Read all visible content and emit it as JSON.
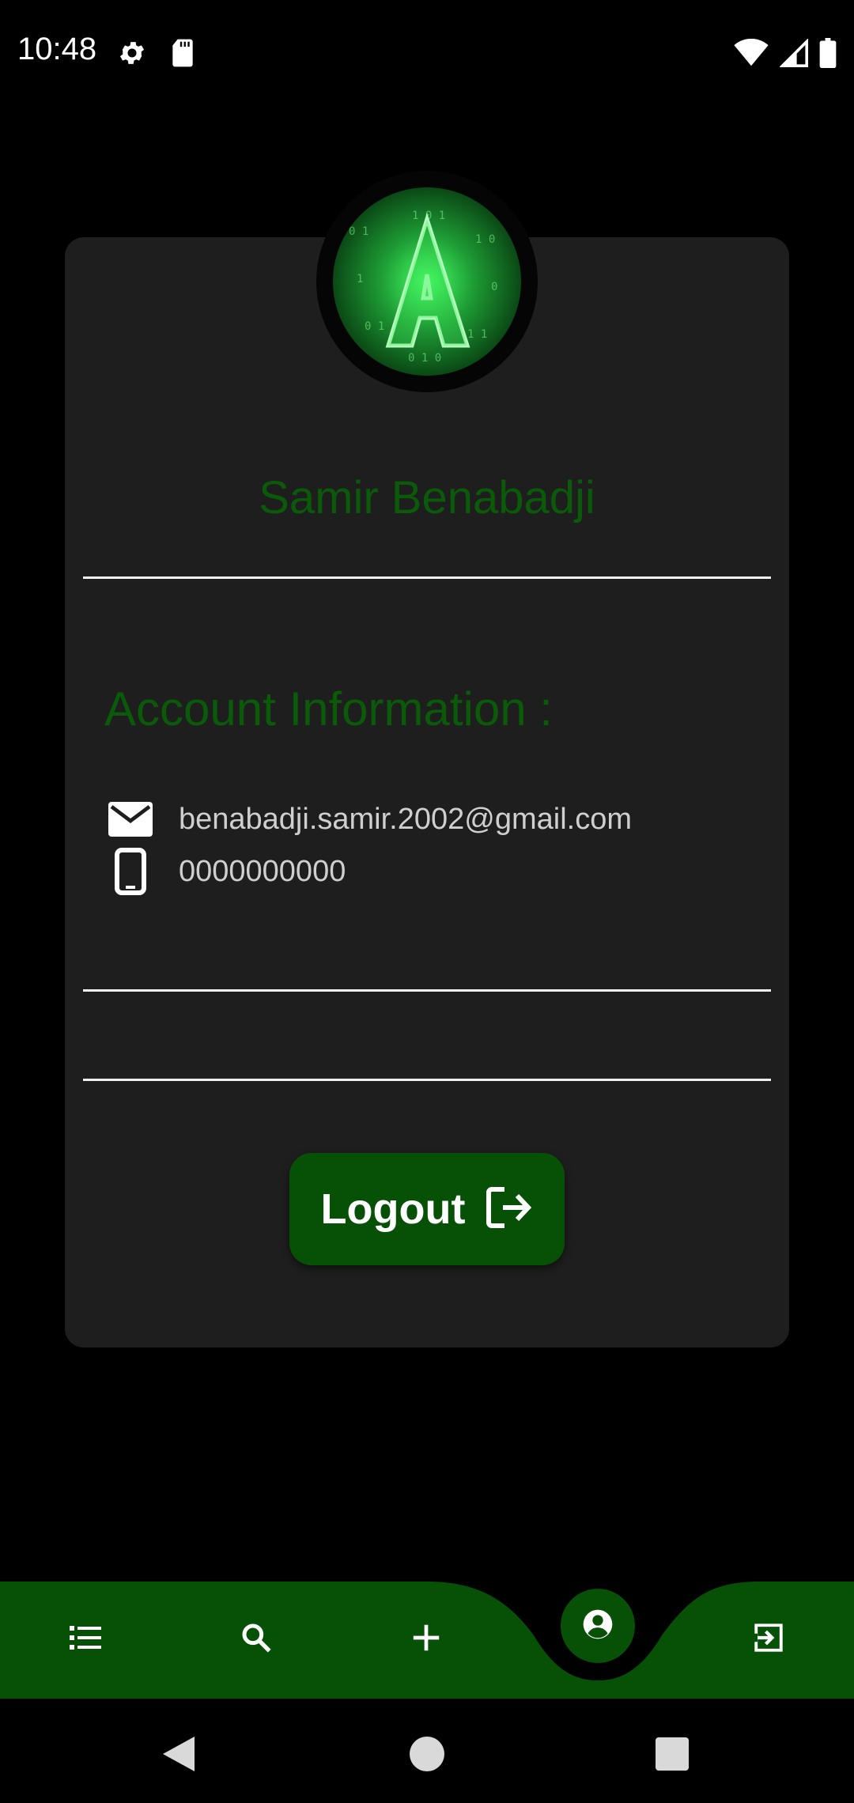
{
  "status_bar": {
    "time": "10:48",
    "left_icons": [
      "settings-icon",
      "sd-card-icon"
    ],
    "right_icons": [
      "wifi-icon",
      "signal-icon",
      "battery-icon"
    ]
  },
  "profile": {
    "name": "Samir Benabadji",
    "avatar": "matrix-a-logo"
  },
  "account": {
    "section_title": "Account Information :",
    "email": "benabadji.samir.2002@gmail.com",
    "phone": "0000000000"
  },
  "actions": {
    "logout_label": "Logout"
  },
  "bottom_nav": {
    "items": [
      "list-icon",
      "search-icon",
      "add-icon",
      "account-icon",
      "exit-icon"
    ],
    "active": "account-icon"
  },
  "colors": {
    "accent": "#075107",
    "name_text": "#0a5a0a",
    "card_bg": "#1e1e1e",
    "background": "#000000"
  }
}
